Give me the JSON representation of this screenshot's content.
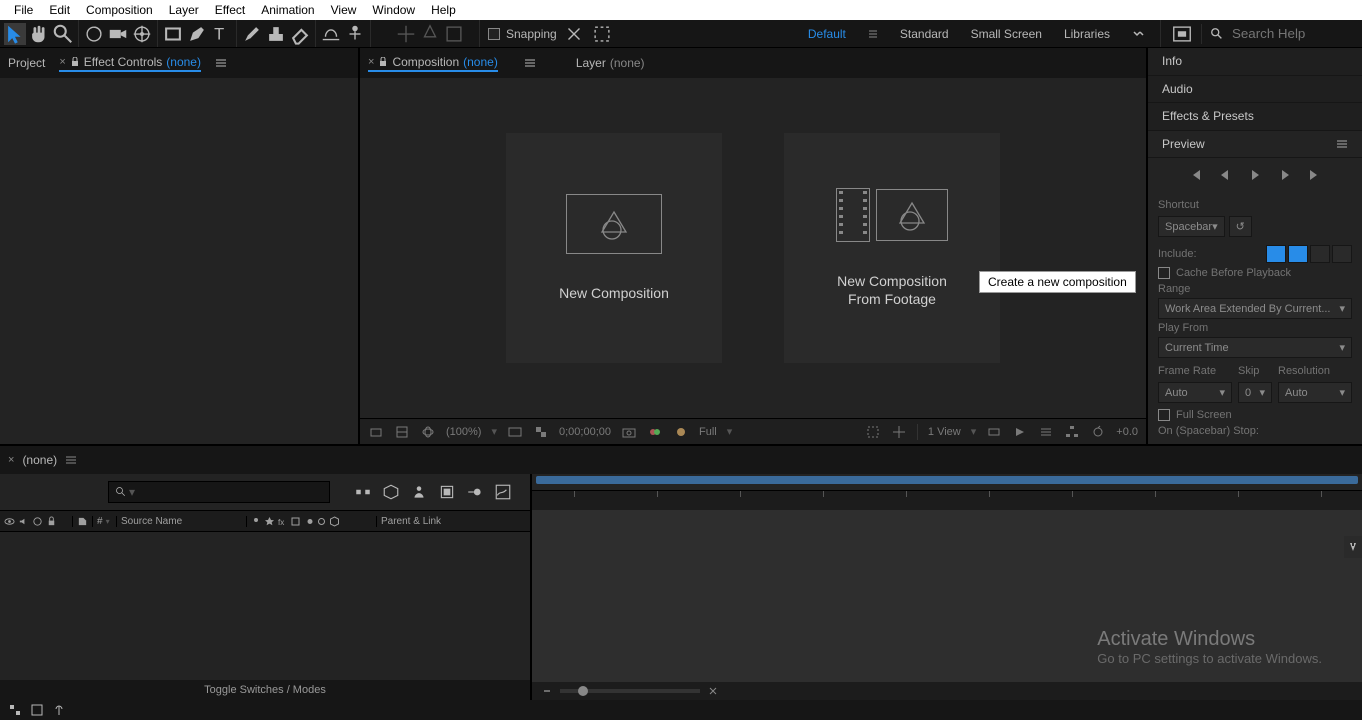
{
  "menu": {
    "file": "File",
    "edit": "Edit",
    "composition": "Composition",
    "layer": "Layer",
    "effect": "Effect",
    "animation": "Animation",
    "view": "View",
    "window": "Window",
    "help": "Help"
  },
  "toolbar": {
    "snapping": "Snapping"
  },
  "workspaces": {
    "default": "Default",
    "standard": "Standard",
    "small": "Small Screen",
    "libraries": "Libraries"
  },
  "search": {
    "placeholder": "Search Help"
  },
  "left": {
    "project": "Project",
    "effectControls": "Effect Controls",
    "none": "(none)"
  },
  "center": {
    "compTab": "Composition",
    "none": "(none)",
    "layerTab": "Layer",
    "layerNone": "(none)",
    "card1": "New Composition",
    "card2a": "New Composition",
    "card2b": "From Footage",
    "tooltip": "Create a new composition",
    "footer": {
      "zoom": "(100%)",
      "time": "0;00;00;00",
      "res": "Full",
      "view": "1 View",
      "exp": "+0.0"
    }
  },
  "right": {
    "info": "Info",
    "audio": "Audio",
    "effects": "Effects & Presets",
    "preview": "Preview",
    "shortcut": "Shortcut",
    "spacebar": "Spacebar",
    "include": "Include:",
    "cache": "Cache Before Playback",
    "range": "Range",
    "workarea": "Work Area Extended By Current...",
    "playfrom": "Play From",
    "current": "Current Time",
    "framerate": "Frame Rate",
    "skip": "Skip",
    "resolution": "Resolution",
    "auto": "Auto",
    "zero": "0",
    "fullscreen": "Full Screen",
    "onstop": "On (Spacebar) Stop:"
  },
  "timeline": {
    "none": "(none)",
    "cols": {
      "hash": "#",
      "source": "Source Name",
      "parent": "Parent & Link"
    },
    "toggle": "Toggle Switches / Modes"
  },
  "watermark": {
    "title": "Activate Windows",
    "sub": "Go to PC settings to activate Windows."
  }
}
